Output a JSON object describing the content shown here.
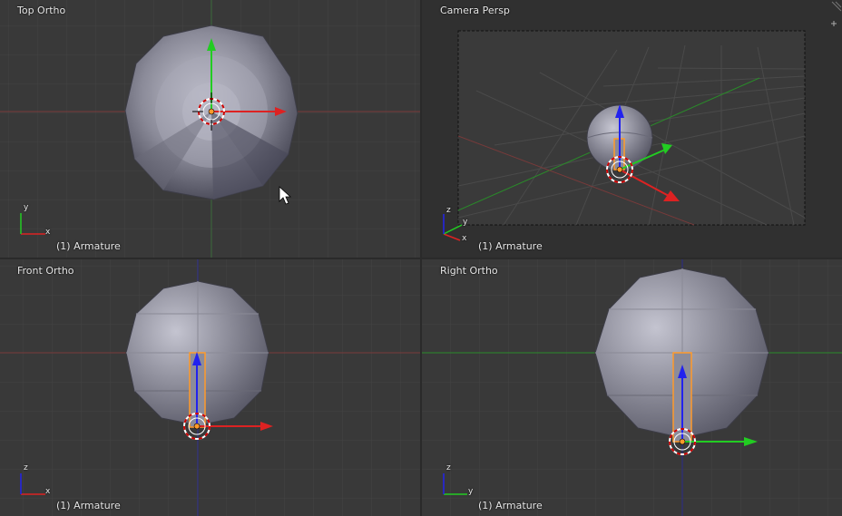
{
  "viewports": {
    "top_left": {
      "view_name": "Top Ortho",
      "object_label": "(1) Armature",
      "axis_a": "x",
      "axis_b": "y"
    },
    "top_right": {
      "view_name": "Camera Persp",
      "object_label": "(1) Armature",
      "axis_a": "x",
      "axis_b": "y",
      "axis_c": "z"
    },
    "bottom_left": {
      "view_name": "Front Ortho",
      "object_label": "(1) Armature",
      "axis_a": "x",
      "axis_b": "z"
    },
    "bottom_right": {
      "view_name": "Right Ortho",
      "object_label": "(1) Armature",
      "axis_a": "y",
      "axis_b": "z"
    }
  },
  "colors": {
    "background": "#393939",
    "camera_background": "#333333",
    "grid": "#444444",
    "x_axis": "#dd2222",
    "y_axis": "#22cc22",
    "z_axis": "#2222ee",
    "sphere_light": "#b4b4c2",
    "sphere_dark": "#5c5c6a",
    "bone_outline": "#ff9a2a"
  },
  "icons": [
    "3d-cursor-icon",
    "transform-manipulator-icon",
    "axis-gizmo-icon",
    "mouse-cursor-icon",
    "view-split-plus-icon"
  ]
}
